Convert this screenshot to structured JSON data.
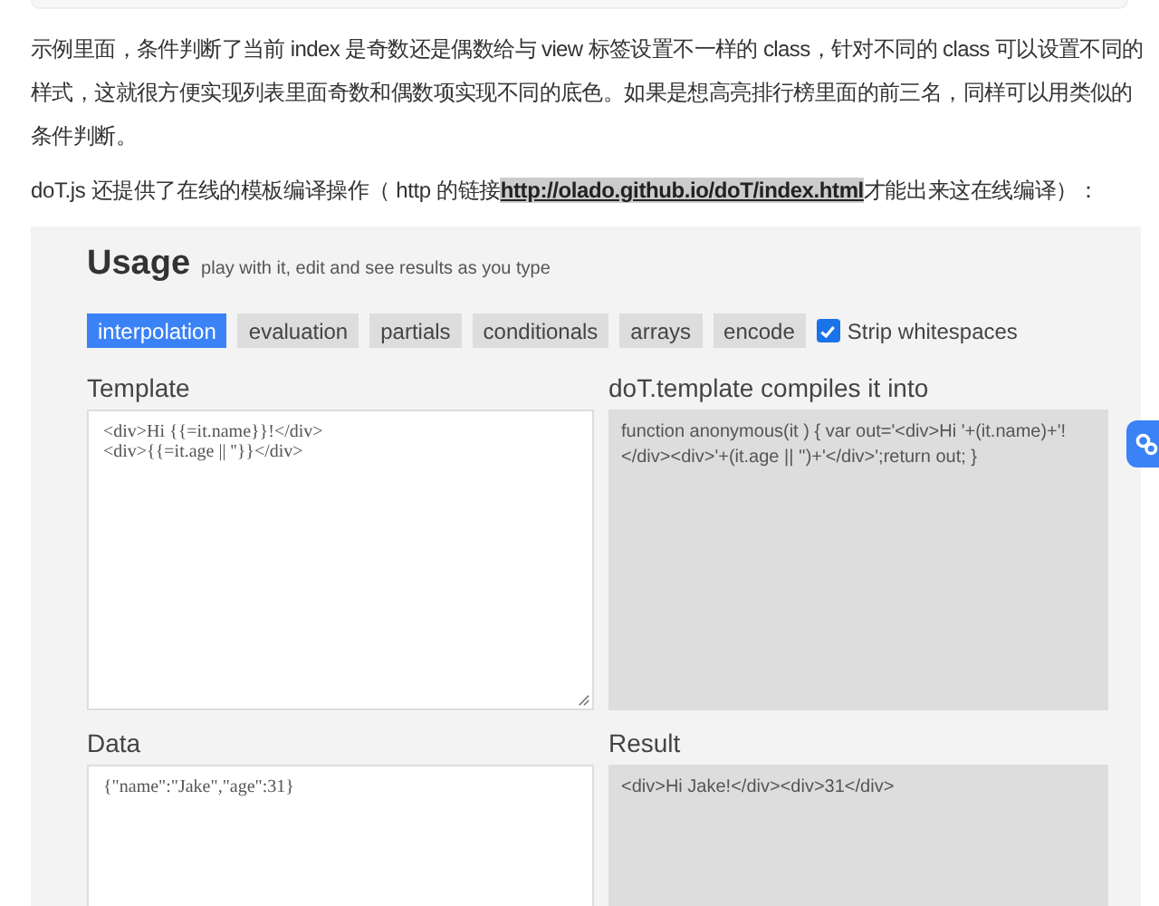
{
  "intro": "示例里面，条件判断了当前 index 是奇数还是偶数给与 view 标签设置不一样的 class，针对不同的 class 可以设置不同的样式，这就很方便实现列表里面奇数和偶数项实现不同的底色。如果是想高亮排行榜里面的前三名，同样可以用类似的条件判断。",
  "online": {
    "before": "doT.js 还提供了在线的模板编译操作（ http 的链接",
    "link": "http://olado.github.io/doT/index.html",
    "after": "才能出来这在线编译）："
  },
  "usage": {
    "title": "Usage",
    "subtitle": "play with it, edit and see results as you type",
    "tabs": [
      {
        "label": "interpolation",
        "selected": true
      },
      {
        "label": "evaluation",
        "selected": false
      },
      {
        "label": "partials",
        "selected": false
      },
      {
        "label": "conditionals",
        "selected": false
      },
      {
        "label": "arrays",
        "selected": false
      },
      {
        "label": "encode",
        "selected": false
      }
    ],
    "strip": {
      "label": "Strip whitespaces",
      "checked": true
    },
    "template": {
      "label": "Template",
      "lines": [
        "<div>Hi {{=it.name}}!</div>",
        "<div>{{=it.age || ''}}</div>"
      ]
    },
    "compiled": {
      "label": "doT.template compiles it into",
      "text": "function anonymous(it ) { var out='<div>Hi '+(it.name)+'!</div><div>'+(it.age || '')+'</div>';return out; }"
    },
    "data": {
      "label": "Data",
      "lines": [
        "{\"name\":\"Jake\",\"age\":31}"
      ]
    },
    "result": {
      "label": "Result",
      "text": "<div>Hi Jake!</div><div>31</div>"
    }
  }
}
